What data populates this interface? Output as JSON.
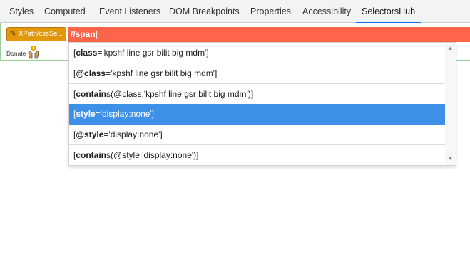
{
  "tabs": [
    {
      "label": "Styles",
      "active": false
    },
    {
      "label": "Computed",
      "active": false
    },
    {
      "label": "Event Listeners",
      "active": false
    },
    {
      "label": "DOM Breakpoints",
      "active": false
    },
    {
      "label": "Properties",
      "active": false
    },
    {
      "label": "Accessibility",
      "active": false
    },
    {
      "label": "SelectorsHub",
      "active": true
    }
  ],
  "toolbar": {
    "xpath_button_label": "XPath/cssSel..",
    "input_value": "//span[",
    "donate_label": "Donate"
  },
  "autocomplete": {
    "options": [
      {
        "key": "class",
        "rest": "='kpshf line gsr bilit big mdm']",
        "prefix": "[",
        "selected": false
      },
      {
        "key": "@class",
        "rest": "='kpshf line gsr bilit big mdm']",
        "prefix": "[",
        "selected": false
      },
      {
        "key": "contain",
        "rest": "s(@class,'kpshf line gsr bilit big mdm')]",
        "prefix": "[",
        "selected": false
      },
      {
        "key": "style",
        "rest": "='display:none']",
        "prefix": "[",
        "selected": true
      },
      {
        "key": "@style",
        "rest": "='display:none']",
        "prefix": "[",
        "selected": false
      },
      {
        "key": "contain",
        "rest": "s(@style,'display:none')]",
        "prefix": "[",
        "selected": false
      }
    ],
    "option_text": [
      "[class='kpshf line gsr bilit big mdm']",
      "[@class='kpshf line gsr bilit big mdm']",
      "[contains(@class,'kpshf line gsr bilit big mdm')]",
      "[style='display:none']",
      "[@style='display:none']",
      "[contains(@style,'display:none')]"
    ]
  },
  "colors": {
    "accent": "#1a73e8",
    "input_bg": "#fc6549",
    "button_bg": "#e2980a",
    "selected_bg": "#3e8fe8"
  },
  "icons": {
    "pencil": "pencil-icon",
    "donate": "donate-hand-icon",
    "scroll_up": "triangle-up-icon",
    "scroll_down": "triangle-down-icon"
  }
}
